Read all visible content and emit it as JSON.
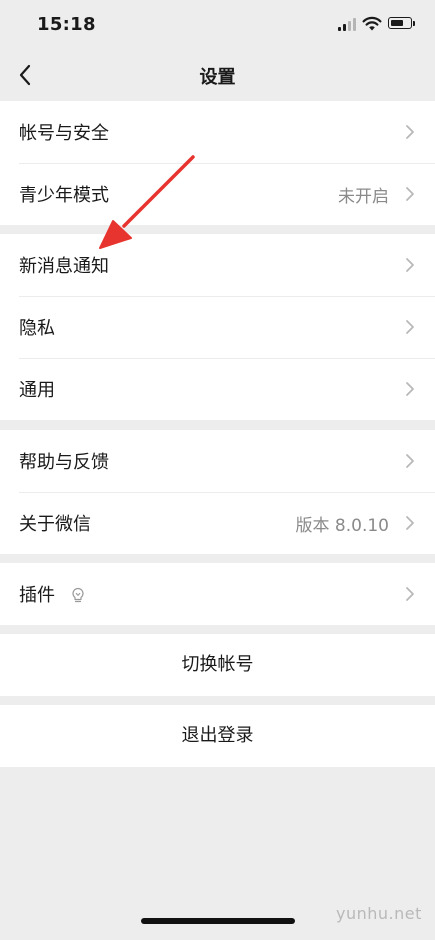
{
  "status_bar": {
    "time": "15:18"
  },
  "nav": {
    "title": "设置"
  },
  "groups": [
    {
      "items": [
        {
          "label": "帐号与安全",
          "value": ""
        },
        {
          "label": "青少年模式",
          "value": "未开启"
        }
      ]
    },
    {
      "items": [
        {
          "label": "新消息通知",
          "value": ""
        },
        {
          "label": "隐私",
          "value": ""
        },
        {
          "label": "通用",
          "value": ""
        }
      ]
    },
    {
      "items": [
        {
          "label": "帮助与反馈",
          "value": ""
        },
        {
          "label": "关于微信",
          "value": "版本 8.0.10"
        }
      ]
    },
    {
      "items": [
        {
          "label": "插件",
          "value": "",
          "icon": "lightbulb-icon"
        }
      ]
    }
  ],
  "buttons": {
    "switch_account": "切换帐号",
    "logout": "退出登录"
  },
  "watermark": "yunhu.net",
  "colors": {
    "background": "#ededed",
    "card": "#ffffff",
    "secondary_text": "#8a8a8a",
    "annotation_arrow": "#e8342e"
  }
}
